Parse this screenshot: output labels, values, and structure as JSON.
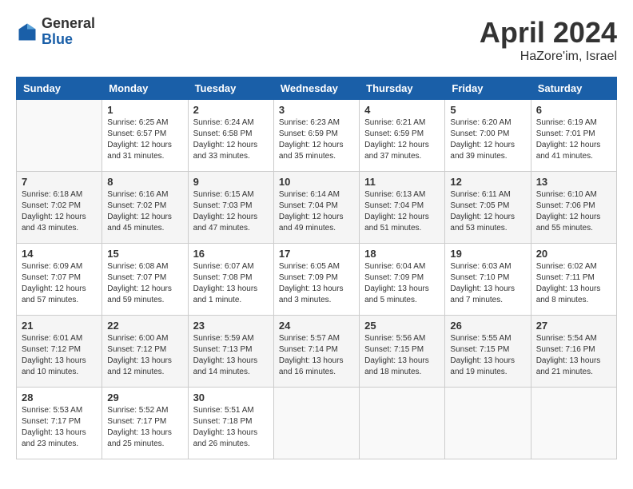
{
  "header": {
    "logo_general": "General",
    "logo_blue": "Blue",
    "title": "April 2024",
    "location": "HaZore'im, Israel"
  },
  "days_of_week": [
    "Sunday",
    "Monday",
    "Tuesday",
    "Wednesday",
    "Thursday",
    "Friday",
    "Saturday"
  ],
  "weeks": [
    [
      {
        "day": "",
        "info": ""
      },
      {
        "day": "1",
        "info": "Sunrise: 6:25 AM\nSunset: 6:57 PM\nDaylight: 12 hours\nand 31 minutes."
      },
      {
        "day": "2",
        "info": "Sunrise: 6:24 AM\nSunset: 6:58 PM\nDaylight: 12 hours\nand 33 minutes."
      },
      {
        "day": "3",
        "info": "Sunrise: 6:23 AM\nSunset: 6:59 PM\nDaylight: 12 hours\nand 35 minutes."
      },
      {
        "day": "4",
        "info": "Sunrise: 6:21 AM\nSunset: 6:59 PM\nDaylight: 12 hours\nand 37 minutes."
      },
      {
        "day": "5",
        "info": "Sunrise: 6:20 AM\nSunset: 7:00 PM\nDaylight: 12 hours\nand 39 minutes."
      },
      {
        "day": "6",
        "info": "Sunrise: 6:19 AM\nSunset: 7:01 PM\nDaylight: 12 hours\nand 41 minutes."
      }
    ],
    [
      {
        "day": "7",
        "info": "Sunrise: 6:18 AM\nSunset: 7:02 PM\nDaylight: 12 hours\nand 43 minutes."
      },
      {
        "day": "8",
        "info": "Sunrise: 6:16 AM\nSunset: 7:02 PM\nDaylight: 12 hours\nand 45 minutes."
      },
      {
        "day": "9",
        "info": "Sunrise: 6:15 AM\nSunset: 7:03 PM\nDaylight: 12 hours\nand 47 minutes."
      },
      {
        "day": "10",
        "info": "Sunrise: 6:14 AM\nSunset: 7:04 PM\nDaylight: 12 hours\nand 49 minutes."
      },
      {
        "day": "11",
        "info": "Sunrise: 6:13 AM\nSunset: 7:04 PM\nDaylight: 12 hours\nand 51 minutes."
      },
      {
        "day": "12",
        "info": "Sunrise: 6:11 AM\nSunset: 7:05 PM\nDaylight: 12 hours\nand 53 minutes."
      },
      {
        "day": "13",
        "info": "Sunrise: 6:10 AM\nSunset: 7:06 PM\nDaylight: 12 hours\nand 55 minutes."
      }
    ],
    [
      {
        "day": "14",
        "info": "Sunrise: 6:09 AM\nSunset: 7:07 PM\nDaylight: 12 hours\nand 57 minutes."
      },
      {
        "day": "15",
        "info": "Sunrise: 6:08 AM\nSunset: 7:07 PM\nDaylight: 12 hours\nand 59 minutes."
      },
      {
        "day": "16",
        "info": "Sunrise: 6:07 AM\nSunset: 7:08 PM\nDaylight: 13 hours\nand 1 minute."
      },
      {
        "day": "17",
        "info": "Sunrise: 6:05 AM\nSunset: 7:09 PM\nDaylight: 13 hours\nand 3 minutes."
      },
      {
        "day": "18",
        "info": "Sunrise: 6:04 AM\nSunset: 7:09 PM\nDaylight: 13 hours\nand 5 minutes."
      },
      {
        "day": "19",
        "info": "Sunrise: 6:03 AM\nSunset: 7:10 PM\nDaylight: 13 hours\nand 7 minutes."
      },
      {
        "day": "20",
        "info": "Sunrise: 6:02 AM\nSunset: 7:11 PM\nDaylight: 13 hours\nand 8 minutes."
      }
    ],
    [
      {
        "day": "21",
        "info": "Sunrise: 6:01 AM\nSunset: 7:12 PM\nDaylight: 13 hours\nand 10 minutes."
      },
      {
        "day": "22",
        "info": "Sunrise: 6:00 AM\nSunset: 7:12 PM\nDaylight: 13 hours\nand 12 minutes."
      },
      {
        "day": "23",
        "info": "Sunrise: 5:59 AM\nSunset: 7:13 PM\nDaylight: 13 hours\nand 14 minutes."
      },
      {
        "day": "24",
        "info": "Sunrise: 5:57 AM\nSunset: 7:14 PM\nDaylight: 13 hours\nand 16 minutes."
      },
      {
        "day": "25",
        "info": "Sunrise: 5:56 AM\nSunset: 7:15 PM\nDaylight: 13 hours\nand 18 minutes."
      },
      {
        "day": "26",
        "info": "Sunrise: 5:55 AM\nSunset: 7:15 PM\nDaylight: 13 hours\nand 19 minutes."
      },
      {
        "day": "27",
        "info": "Sunrise: 5:54 AM\nSunset: 7:16 PM\nDaylight: 13 hours\nand 21 minutes."
      }
    ],
    [
      {
        "day": "28",
        "info": "Sunrise: 5:53 AM\nSunset: 7:17 PM\nDaylight: 13 hours\nand 23 minutes."
      },
      {
        "day": "29",
        "info": "Sunrise: 5:52 AM\nSunset: 7:17 PM\nDaylight: 13 hours\nand 25 minutes."
      },
      {
        "day": "30",
        "info": "Sunrise: 5:51 AM\nSunset: 7:18 PM\nDaylight: 13 hours\nand 26 minutes."
      },
      {
        "day": "",
        "info": ""
      },
      {
        "day": "",
        "info": ""
      },
      {
        "day": "",
        "info": ""
      },
      {
        "day": "",
        "info": ""
      }
    ]
  ]
}
